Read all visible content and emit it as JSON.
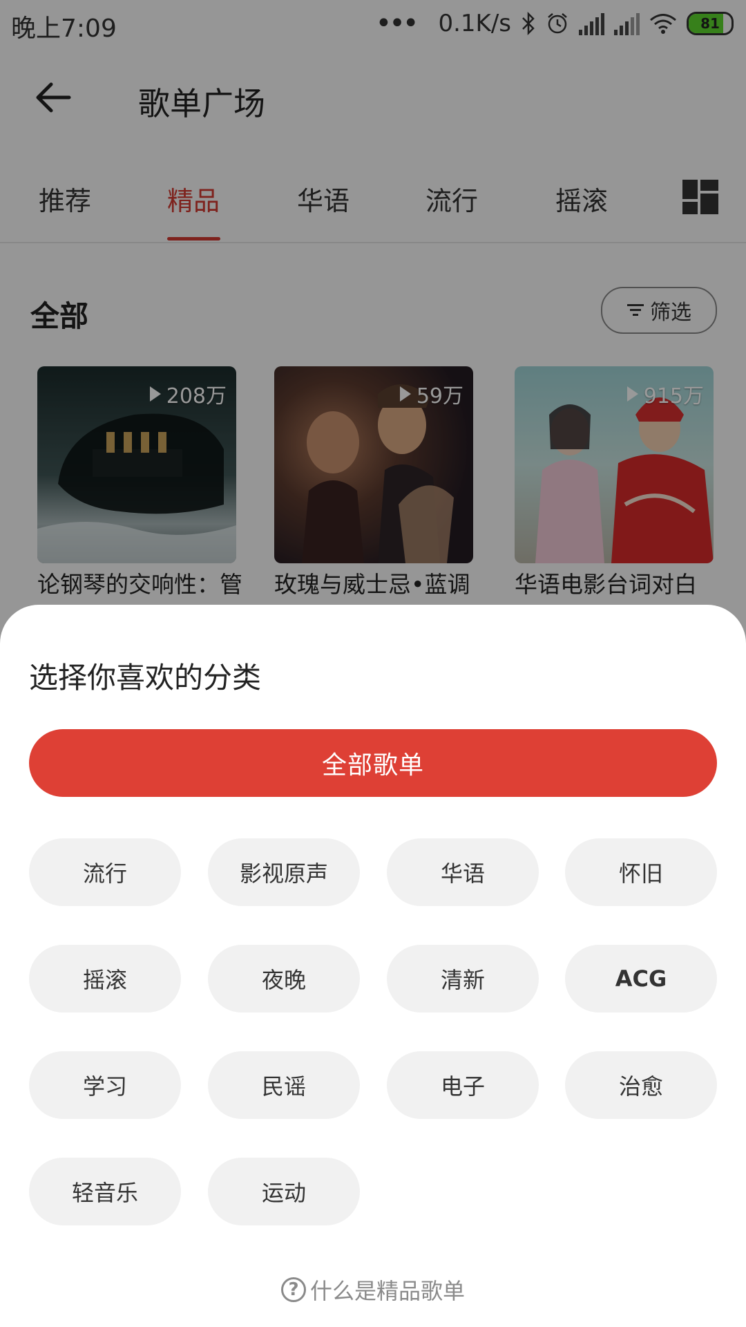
{
  "status_bar": {
    "time": "晚上7:09",
    "network_speed": "0.1K/s",
    "battery_level": "81",
    "icons": [
      "more-dots-icon",
      "bluetooth-icon",
      "alarm-icon",
      "hd-signal-icon",
      "signal-icon",
      "wifi-icon",
      "battery-icon"
    ]
  },
  "header": {
    "title": "歌单广场",
    "back_icon": "back-arrow-icon"
  },
  "tabs": {
    "items": [
      "推荐",
      "精品",
      "华语",
      "流行",
      "摇滚"
    ],
    "active": "精品",
    "layout_icon": "grid-layout-icon"
  },
  "section": {
    "title": "全部",
    "filter_label": "筛选"
  },
  "playlists": [
    {
      "play_count": "208万",
      "title": "论钢琴的交响性：管"
    },
    {
      "play_count": "59万",
      "title": "玫瑰与威士忌•蓝调"
    },
    {
      "play_count": "915万",
      "title": "华语电影台词对白"
    }
  ],
  "sheet": {
    "title": "选择你喜欢的分类",
    "all_button": "全部歌单",
    "categories": [
      "流行",
      "影视原声",
      "华语",
      "怀旧",
      "摇滚",
      "夜晚",
      "清新",
      "ACG",
      "学习",
      "民谣",
      "电子",
      "治愈",
      "轻音乐",
      "运动"
    ],
    "help_text": "什么是精品歌单"
  },
  "colors": {
    "accent": "#de4035",
    "chip_bg": "#f1f1f1",
    "overlay": "rgba(0,0,0,0.40)"
  }
}
